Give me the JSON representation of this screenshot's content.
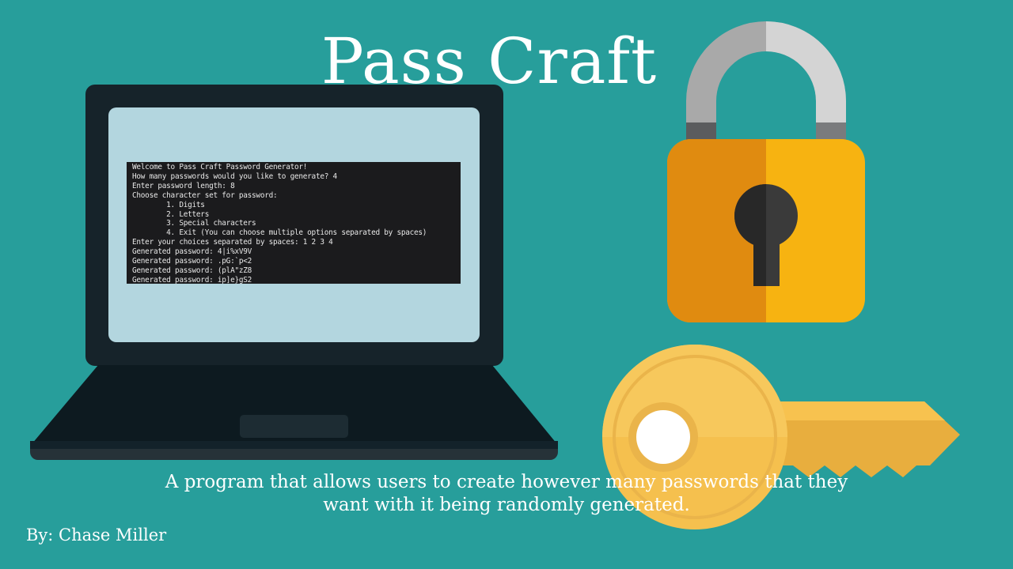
{
  "slide": {
    "title": "Pass Craft",
    "description_lines": [
      "A program that allows users to create however many passwords that they",
      "want with it being randomly generated."
    ],
    "author": "By: Chase Miller"
  },
  "terminal": {
    "lines": [
      "Welcome to Pass Craft Password Generator!",
      "How many passwords would you like to generate? 4",
      "Enter password length: 8",
      "Choose character set for password:",
      "        1. Digits",
      "        2. Letters",
      "        3. Special characters",
      "        4. Exit (You can choose multiple options separated by spaces)",
      "Enter your choices separated by spaces: 1 2 3 4",
      "Generated password: 4|i%xV9V",
      "Generated password: .pG:`p<2",
      "Generated password: (plA\"zZ8",
      "Generated password: ip]e}gS2"
    ]
  },
  "icons": [
    "laptop-icon",
    "padlock-icon",
    "key-icon"
  ],
  "colors": {
    "background": "#279e9b",
    "laptop_body": "#16232a",
    "laptop_screen": "#b3d6df",
    "terminal_bg": "#1b1b1d",
    "padlock_gold": "#f7b311",
    "padlock_shade": "#e08b10",
    "key_gold": "#f5c04e",
    "text": "#ffffff"
  }
}
